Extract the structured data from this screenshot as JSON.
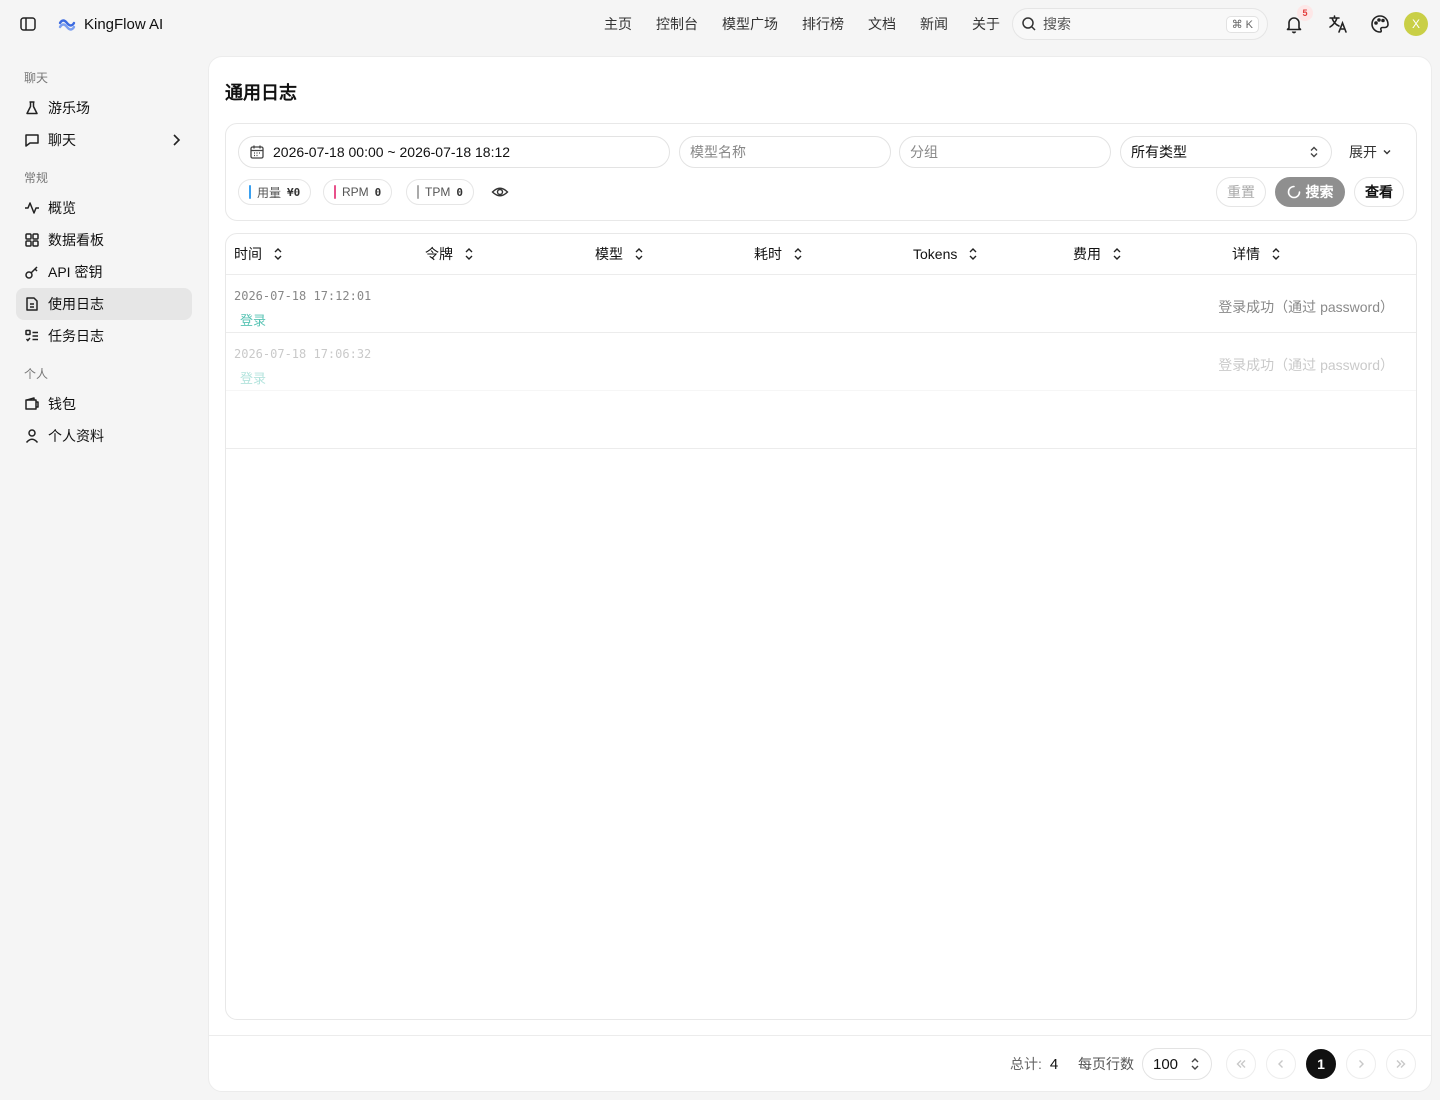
{
  "brand": {
    "name": "KingFlow AI"
  },
  "nav": [
    "主页",
    "控制台",
    "模型广场",
    "排行榜",
    "文档",
    "新闻",
    "关于"
  ],
  "search": {
    "placeholder": "搜索",
    "shortcut": "⌘ K"
  },
  "notifications": {
    "count": "5"
  },
  "user": {
    "initial": "X"
  },
  "colors": {
    "accent_teal": "#58c3b4",
    "avatar": "#c9cf46",
    "usage_bar": "#3aa0f0",
    "rpm_bar": "#e8508a",
    "tpm_bar": "#aaaaaa"
  },
  "sidebar": {
    "groups": [
      {
        "label": "聊天",
        "items": [
          {
            "label": "游乐场",
            "icon": "flask-icon"
          },
          {
            "label": "聊天",
            "icon": "chat-icon",
            "expandable": true
          }
        ]
      },
      {
        "label": "常规",
        "items": [
          {
            "label": "概览",
            "icon": "activity-icon"
          },
          {
            "label": "数据看板",
            "icon": "dashboard-icon"
          },
          {
            "label": "API 密钥",
            "icon": "key-icon"
          },
          {
            "label": "使用日志",
            "icon": "file-icon",
            "active": true
          },
          {
            "label": "任务日志",
            "icon": "list-icon"
          }
        ]
      },
      {
        "label": "个人",
        "items": [
          {
            "label": "钱包",
            "icon": "wallet-icon"
          },
          {
            "label": "个人资料",
            "icon": "user-icon"
          }
        ]
      }
    ]
  },
  "page": {
    "title": "通用日志"
  },
  "filters": {
    "date_range": "2026-07-18 00:00 ~ 2026-07-18 18:12",
    "model_placeholder": "模型名称",
    "group_placeholder": "分组",
    "type_selected": "所有类型",
    "expand_label": "展开"
  },
  "stats": [
    {
      "label": "用量",
      "value": "¥0"
    },
    {
      "label": "RPM",
      "value": "0"
    },
    {
      "label": "TPM",
      "value": "0"
    }
  ],
  "buttons": {
    "reset": "重置",
    "search": "搜索",
    "view": "查看"
  },
  "table": {
    "columns": [
      "时间",
      "令牌",
      "模型",
      "耗时",
      "Tokens",
      "费用",
      "详情"
    ],
    "rows": [
      {
        "time": "2026-07-18 17:12:01",
        "type": "登录",
        "detail": "登录成功（通过 password）"
      },
      {
        "time": "2026-07-18 17:06:32",
        "type": "登录",
        "detail": "登录成功（通过 password）"
      }
    ]
  },
  "pagination": {
    "total_label": "总计:",
    "total": "4",
    "per_page_label": "每页行数",
    "page_size": "100",
    "current_page": "1"
  }
}
